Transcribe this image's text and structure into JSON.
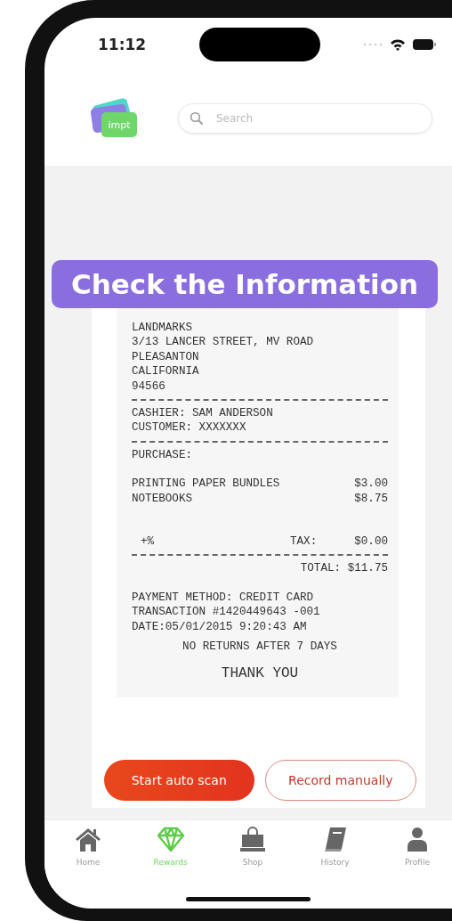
{
  "status_bar": {
    "time": "11:12"
  },
  "header": {
    "logo": "impt",
    "search": {
      "placeholder": "Search"
    }
  },
  "banner": "Check the Information",
  "receipt": [
    {
      "kind": "text",
      "text": "LANDMARKS"
    },
    {
      "kind": "text",
      "text": "3/13 LANCER STREET, MV ROAD"
    },
    {
      "kind": "text",
      "text": "PLEASANTON"
    },
    {
      "kind": "text",
      "text": "CALIFORNIA"
    },
    {
      "kind": "text",
      "text": "94566"
    },
    {
      "kind": "divider"
    },
    {
      "kind": "text",
      "text": "CASHIER: SAM ANDERSON"
    },
    {
      "kind": "text",
      "text": "CUSTOMER: XXXXXXX"
    },
    {
      "kind": "divider"
    },
    {
      "kind": "text",
      "text": "PURCHASE:"
    },
    {
      "kind": "spacer"
    },
    {
      "kind": "item",
      "name": "PRINTING PAPER BUNDLES",
      "price": "$3.00"
    },
    {
      "kind": "item",
      "name": "NOTEBOOKS",
      "price": "$8.75"
    },
    {
      "kind": "spacer"
    },
    {
      "kind": "spacer"
    },
    {
      "kind": "tax",
      "rate": "+%",
      "label": "TAX:",
      "price": "$0.00"
    },
    {
      "kind": "divider"
    },
    {
      "kind": "total",
      "text": "TOTAL: $11.75"
    },
    {
      "kind": "spacer"
    },
    {
      "kind": "text",
      "text": "PAYMENT METHOD: CREDIT CARD"
    },
    {
      "kind": "text",
      "text": "TRANSACTION #1420449643 -001"
    },
    {
      "kind": "text",
      "text": "DATE:05/01/2015 9:20:43 AM"
    },
    {
      "kind": "center",
      "text": "NO RETURNS AFTER 7 DAYS"
    },
    {
      "kind": "thanks",
      "text": "THANK YOU"
    }
  ],
  "buttons": {
    "primary": "Start auto scan",
    "secondary": "Record manually"
  },
  "tabs": [
    {
      "label": "Home",
      "kind": "home",
      "selected": false
    },
    {
      "label": "Rewards",
      "kind": "rewards",
      "selected": true
    },
    {
      "label": "Shop",
      "kind": "shop",
      "selected": false
    },
    {
      "label": "History",
      "kind": "history",
      "selected": false
    },
    {
      "label": "Profile",
      "kind": "profile",
      "selected": false
    }
  ]
}
